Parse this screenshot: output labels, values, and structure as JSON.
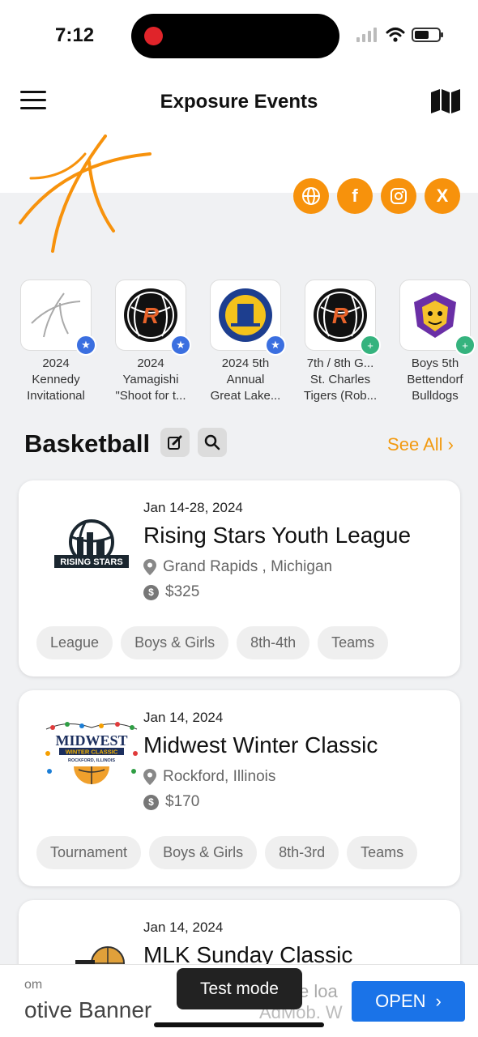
{
  "status_bar": {
    "time": "7:12",
    "battery_level": 0.6
  },
  "header": {
    "title": "Exposure Events",
    "menu_icon": "hamburger-menu-icon",
    "map_icon": "map-icon"
  },
  "socials": [
    {
      "name": "globe-icon",
      "glyph": ""
    },
    {
      "name": "facebook-icon",
      "glyph": "f"
    },
    {
      "name": "instagram-icon",
      "glyph": ""
    },
    {
      "name": "x-icon",
      "glyph": "X"
    }
  ],
  "featured": [
    {
      "label": "2024\nKennedy\nInvitational",
      "badge": "star"
    },
    {
      "label": "2024\nYamagishi\n\"Shoot for t...",
      "badge": "star"
    },
    {
      "label": "2024 5th\nAnnual\nGreat Lake...",
      "badge": "star"
    },
    {
      "label": "7th / 8th G...\nSt. Charles\nTigers (Rob...",
      "badge": "group"
    },
    {
      "label": "Boys 5th\nBettendorf\nBulldogs",
      "badge": "group"
    }
  ],
  "section": {
    "title": "Basketball",
    "see_all": "See All"
  },
  "events": [
    {
      "date": "Jan 14-28, 2024",
      "title": "Rising Stars Youth League",
      "location": "Grand Rapids , Michigan",
      "price": "$325",
      "logo_text": "RISING STARS",
      "tags": [
        "League",
        "Boys & Girls",
        "8th-4th",
        "Teams"
      ]
    },
    {
      "date": "Jan 14, 2024",
      "title": "Midwest Winter Classic",
      "location": "Rockford, Illinois",
      "price": "$170",
      "logo_text": "MIDWEST",
      "logo_subtext": "WINTER CLASSIC",
      "logo_subtext2": "ROCKFORD, ILLINOIS",
      "tags": [
        "Tournament",
        "Boys & Girls",
        "8th-3rd",
        "Teams"
      ]
    },
    {
      "date": "Jan 14, 2024",
      "title": "MLK Sunday Classic"
    }
  ],
  "ad": {
    "small_text": "om",
    "big_text": "otive Banner",
    "faded1": "ve loa",
    "faded2": "AdMob. W",
    "open_label": "OPEN"
  },
  "toast": {
    "text": "Test mode"
  },
  "colors": {
    "accent": "#f7920c",
    "see_all": "#f29a10",
    "badge_blue": "#3b6fe0",
    "badge_green": "#35b37e",
    "ad_button": "#1a73e8"
  }
}
